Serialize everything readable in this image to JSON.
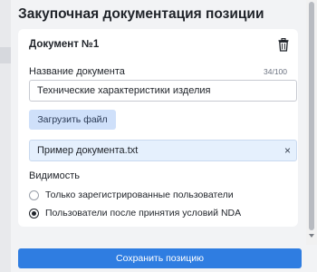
{
  "panel": {
    "title": "Закупочная документация позиции"
  },
  "document": {
    "title": "Документ №1",
    "name_label": "Название документа",
    "name_counter": "34/100",
    "name_value": "Технические характеристики изделия",
    "upload_label": "Загрузить файл",
    "file_name": "Пример документа.txt",
    "file_remove_glyph": "×"
  },
  "visibility": {
    "label": "Видимость",
    "options": [
      {
        "label": "Только зарегистрированные пользователи",
        "checked": false
      },
      {
        "label": "Пользователи после принятия условий NDA",
        "checked": true
      }
    ]
  },
  "footer": {
    "save_label": "Сохранить позицию"
  },
  "colors": {
    "accent": "#2f7de1",
    "upload_button_bg": "#cfe0fa",
    "file_chip_bg": "#e5f0fd",
    "panel_bg": "#f2f3f5",
    "card_bg": "#ffffff"
  },
  "icons": {
    "delete": "trash-icon",
    "remove_file": "close-icon"
  }
}
